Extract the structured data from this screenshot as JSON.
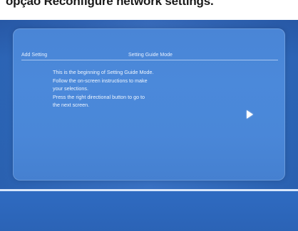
{
  "caption": "opção Reconfigure network settings.",
  "header": {
    "left": "Add Setting",
    "right": "Setting Guide Mode"
  },
  "body": {
    "lines": [
      "This is the beginning of Setting Guide Mode.",
      "Follow the on-screen instructions to make",
      "your selections.",
      "Press the right directional button to go to",
      "the next screen."
    ]
  },
  "next_button": {
    "icon": "right-arrow-icon"
  },
  "colors": {
    "background": "#2e6bc2",
    "panel": "#4a87d8",
    "text": "#eef5ff",
    "divider": "#d8e6fb"
  }
}
